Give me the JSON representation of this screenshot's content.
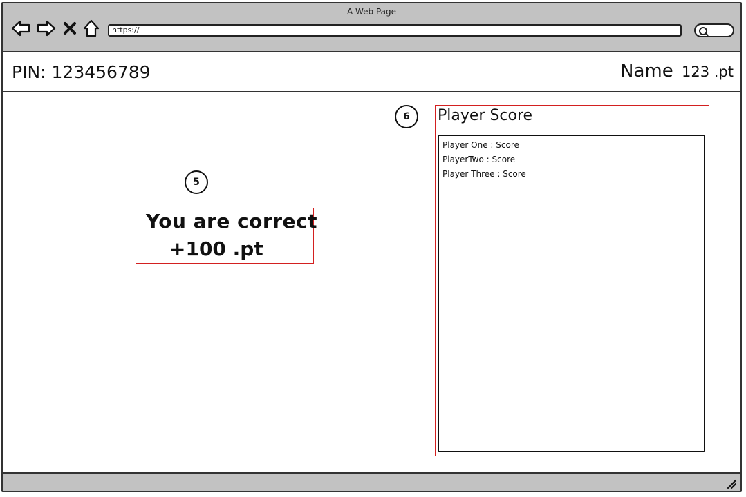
{
  "browser": {
    "window_title": "A Web Page",
    "url": "https://",
    "icons": [
      "back-arrow-icon",
      "forward-arrow-icon",
      "close-x-icon",
      "home-icon",
      "search-icon"
    ]
  },
  "header": {
    "pin": "PIN: 123456789",
    "name": "Name",
    "points": "123 .pt"
  },
  "callouts": {
    "result": "5",
    "scores": "6"
  },
  "result": {
    "message": "You are correct",
    "points": "+100 .pt"
  },
  "scoreboard": {
    "title": "Player Score",
    "players": [
      "Player One : Score",
      "PlayerTwo : Score",
      "Player Three : Score"
    ]
  },
  "colors": {
    "chrome": "#c2c2c2",
    "highlight_border": "#d32020"
  }
}
